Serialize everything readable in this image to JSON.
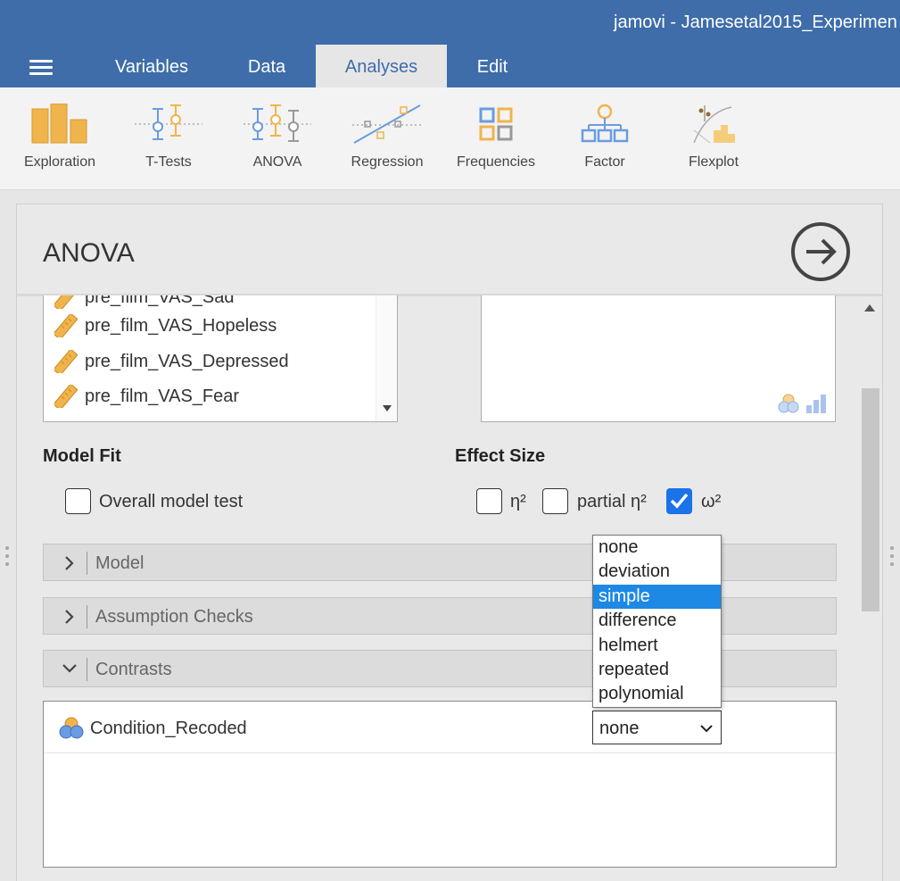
{
  "window": {
    "title": "jamovi - Jamesetal2015_Experimen"
  },
  "tabs": [
    {
      "label": "Variables"
    },
    {
      "label": "Data"
    },
    {
      "label": "Analyses",
      "active": true
    },
    {
      "label": "Edit"
    }
  ],
  "ribbon": [
    {
      "label": "Exploration",
      "icon": "exploration-bars-icon"
    },
    {
      "label": "T-Tests",
      "icon": "t-tests-icon"
    },
    {
      "label": "ANOVA",
      "icon": "anova-icon"
    },
    {
      "label": "Regression",
      "icon": "regression-icon"
    },
    {
      "label": "Frequencies",
      "icon": "frequencies-icon"
    },
    {
      "label": "Factor",
      "icon": "factor-icon"
    },
    {
      "label": "Flexplot",
      "icon": "flexplot-icon"
    }
  ],
  "panel": {
    "title": "ANOVA",
    "variables": [
      "pre_film_VAS_Sad",
      "pre_film_VAS_Hopeless",
      "pre_film_VAS_Depressed",
      "pre_film_VAS_Fear"
    ],
    "model_fit": {
      "title": "Model Fit",
      "overall_model_test": {
        "label": "Overall model test",
        "checked": false
      }
    },
    "effect_size": {
      "title": "Effect Size",
      "eta_sq": {
        "label": "η²",
        "checked": false
      },
      "partial_eta_sq": {
        "label": "partial η²",
        "checked": false
      },
      "omega_sq": {
        "label": "ω²",
        "checked": true
      }
    },
    "sections": [
      {
        "label": "Model",
        "expanded": false
      },
      {
        "label": "Assumption Checks",
        "expanded": false
      },
      {
        "label": "Contrasts",
        "expanded": true
      }
    ],
    "contrasts": {
      "factor": "Condition_Recoded",
      "selected": "none",
      "options": [
        "none",
        "deviation",
        "simple",
        "difference",
        "helmert",
        "repeated",
        "polynomial"
      ],
      "highlighted": "simple"
    }
  },
  "colors": {
    "titlebar": "#3e6da9",
    "accent_orange": "#f0b44c",
    "accent_blue": "#6b9be0",
    "highlight": "#1e88e5",
    "checkbox_checked": "#1a73e8"
  }
}
